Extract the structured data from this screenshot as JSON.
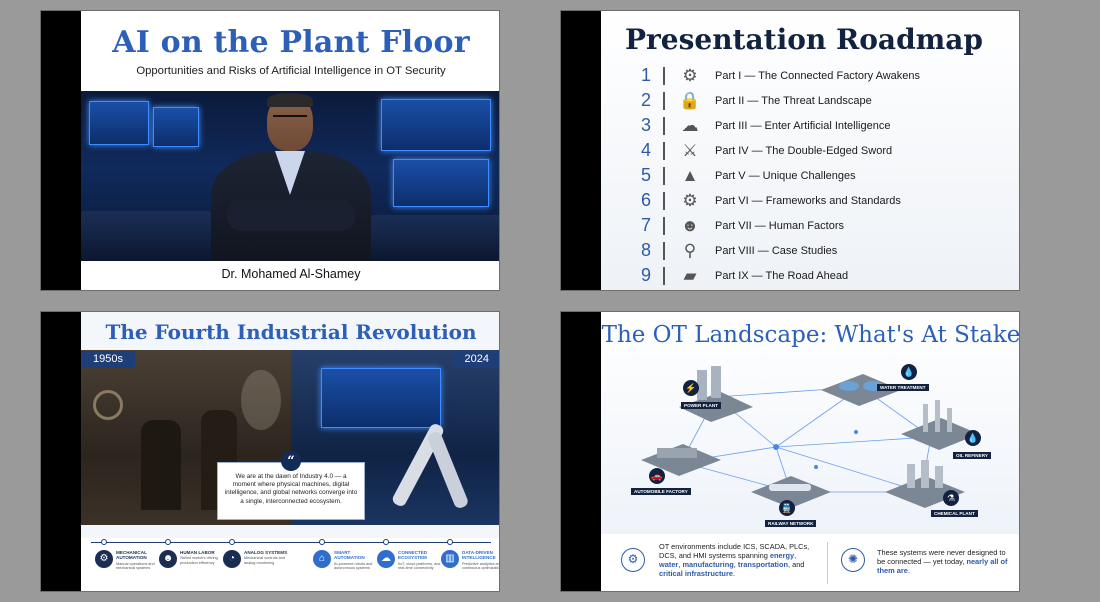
{
  "slides": {
    "s1": {
      "title": "AI on the Plant Floor",
      "subtitle": "Opportunities and Risks of Artificial Intelligence in OT Security",
      "author": "Dr. Mohamed Al-Shamey"
    },
    "s2": {
      "title": "Presentation Roadmap",
      "items": [
        {
          "num": "1",
          "label": "Part I — The Connected Factory Awakens",
          "icon": "robot-arm-icon",
          "glyph": "⚙"
        },
        {
          "num": "2",
          "label": "Part II — The Threat Landscape",
          "icon": "padlock-icon",
          "glyph": "🔒"
        },
        {
          "num": "3",
          "label": "Part III — Enter Artificial Intelligence",
          "icon": "brain-icon",
          "glyph": "☁"
        },
        {
          "num": "4",
          "label": "Part IV — The Double-Edged Sword",
          "icon": "sword-icon",
          "glyph": "⚔"
        },
        {
          "num": "5",
          "label": "Part V — Unique Challenges",
          "icon": "mountain-icon",
          "glyph": "▲"
        },
        {
          "num": "6",
          "label": "Part VI — Frameworks and Standards",
          "icon": "gears-icon",
          "glyph": "⚙"
        },
        {
          "num": "7",
          "label": "Part VII — Human Factors",
          "icon": "people-icon",
          "glyph": "☻"
        },
        {
          "num": "8",
          "label": "Part VIII — Case Studies",
          "icon": "magnifier-icon",
          "glyph": "⚲"
        },
        {
          "num": "9",
          "label": "Part IX — The Road Ahead",
          "icon": "road-icon",
          "glyph": "▰"
        }
      ]
    },
    "s3": {
      "title": "The Fourth Industrial Revolution",
      "era_left": "1950s",
      "era_right": "2024",
      "quote": "We are at the dawn of Industry 4.0 — a moment where physical machines, digital intelligence, and global networks converge into a single, interconnected ecosystem.",
      "quote_glyph": "“",
      "timeline": [
        {
          "head": "MECHANICAL AUTOMATION",
          "sub": "Manual operations and mechanical systems",
          "icon": "gears-icon",
          "glyph": "⚙",
          "modern": false
        },
        {
          "head": "HUMAN LABOR",
          "sub": "Skilled workers driving production efficiency",
          "icon": "worker-icon",
          "glyph": "☻",
          "modern": false
        },
        {
          "head": "ANALOG SYSTEMS",
          "sub": "Mechanical controls and analog monitoring",
          "icon": "gauge-icon",
          "glyph": "◔",
          "modern": false
        },
        {
          "head": "SMART AUTOMATION",
          "sub": "AI-powered robots and autonomous systems",
          "icon": "smart-factory-icon",
          "glyph": "⌂",
          "modern": true
        },
        {
          "head": "CONNECTED ECOSYSTEM",
          "sub": "IIoT, cloud platforms, and real-time connectivity",
          "icon": "cloud-icon",
          "glyph": "☁",
          "modern": true
        },
        {
          "head": "DATA-DRIVEN INTELLIGENCE",
          "sub": "Predictive analytics and continuous optimization",
          "icon": "chart-icon",
          "glyph": "▥",
          "modern": true
        }
      ]
    },
    "s4": {
      "title": "The OT Landscape: What's At Stake",
      "sites": {
        "power": "POWER PLANT",
        "water": "WATER TREATMENT",
        "oil": "OIL REFINERY",
        "auto": "AUTOMOBILE FACTORY",
        "rail": "RAILWAY NETWORK",
        "chem": "CHEMICAL PLANT"
      },
      "site_glyphs": {
        "power": "⚡",
        "water": "💧",
        "oil": "💧",
        "auto": "🚗",
        "rail": "🚆",
        "chem": "⚗"
      },
      "footer_left": {
        "lead": "OT environments include ICS, SCADA, PLCs, DCS, and HMI systems spanning",
        "h1": "energy",
        "c1": ",",
        "h2": "water",
        "c2": ",",
        "h3": "manufacturing",
        "c3": ",",
        "h4": "transportation",
        "c4": ", and",
        "h5": "critical infrastructure",
        "end": "."
      },
      "footer_right": {
        "lead": "These systems were never designed to be connected — yet today,",
        "hl": "nearly all of them are",
        "end": "."
      },
      "footer_glyphs": {
        "shield": "⚙",
        "network": "✺"
      }
    }
  },
  "colors": {
    "accent": "#2d5fb8",
    "navy": "#13233f",
    "era_tag": "#1d3e76"
  }
}
